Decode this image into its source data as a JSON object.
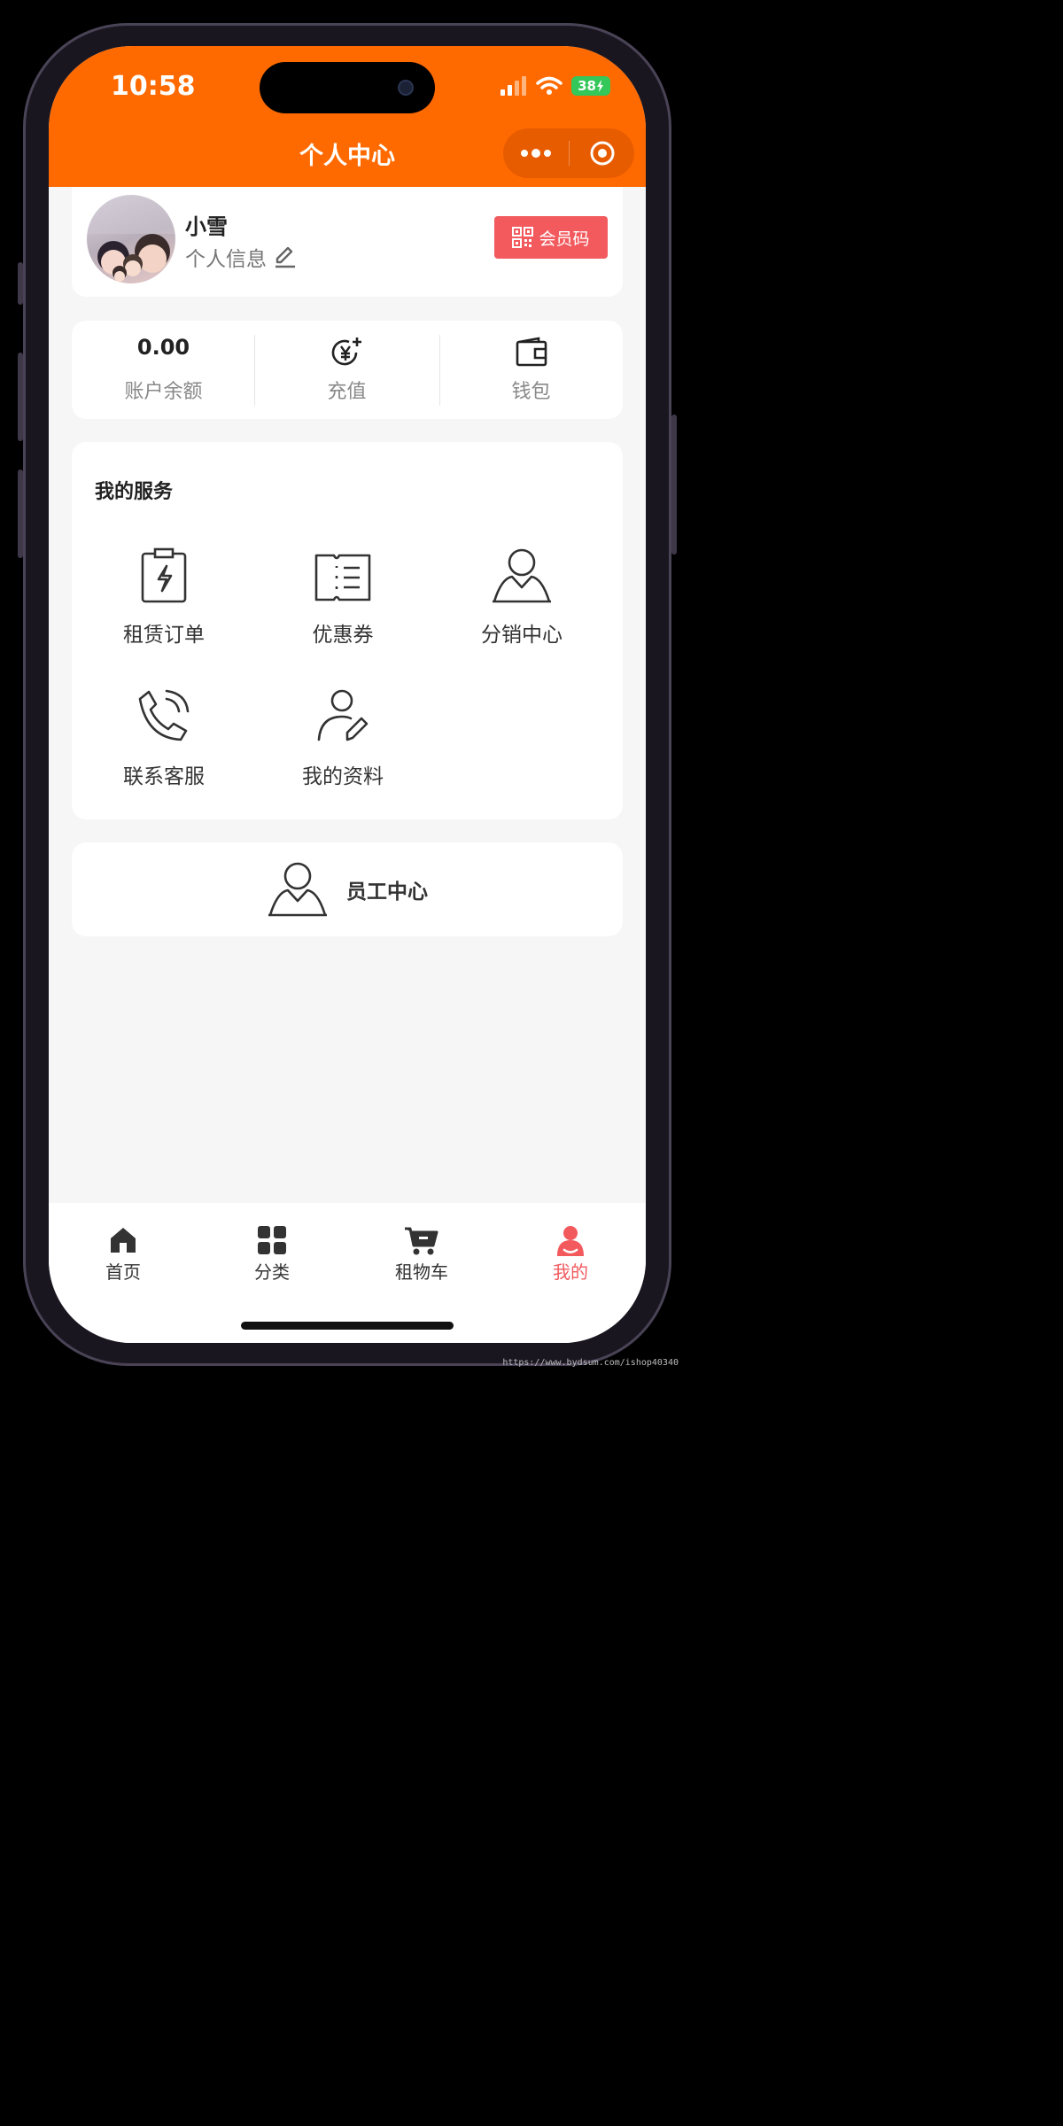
{
  "status_bar": {
    "time": "10:58",
    "battery": "38"
  },
  "nav": {
    "title": "个人中心"
  },
  "profile": {
    "name": "小雪",
    "info_label": "个人信息",
    "member_code_label": "会员码"
  },
  "balance": {
    "amount": "0.00",
    "amount_label": "账户余额",
    "recharge_label": "充值",
    "wallet_label": "钱包"
  },
  "services": {
    "title": "我的服务",
    "items": [
      {
        "label": "租赁订单",
        "icon": "clipboard-lightning-icon"
      },
      {
        "label": "优惠券",
        "icon": "ticket-icon"
      },
      {
        "label": "分销中心",
        "icon": "user-icon"
      },
      {
        "label": "联系客服",
        "icon": "phone-icon"
      },
      {
        "label": "我的资料",
        "icon": "user-edit-icon"
      }
    ]
  },
  "staff": {
    "label": "员工中心"
  },
  "tabbar": {
    "items": [
      {
        "label": "首页",
        "icon": "home-icon"
      },
      {
        "label": "分类",
        "icon": "grid-icon"
      },
      {
        "label": "租物车",
        "icon": "cart-icon"
      },
      {
        "label": "我的",
        "icon": "profile-icon",
        "active": true
      }
    ],
    "active_color": "#f25a5e"
  },
  "colors": {
    "brand": "#ff6a00",
    "accent": "#f25a5e"
  },
  "watermark": "https://www.bydsum.com/ishop40340"
}
